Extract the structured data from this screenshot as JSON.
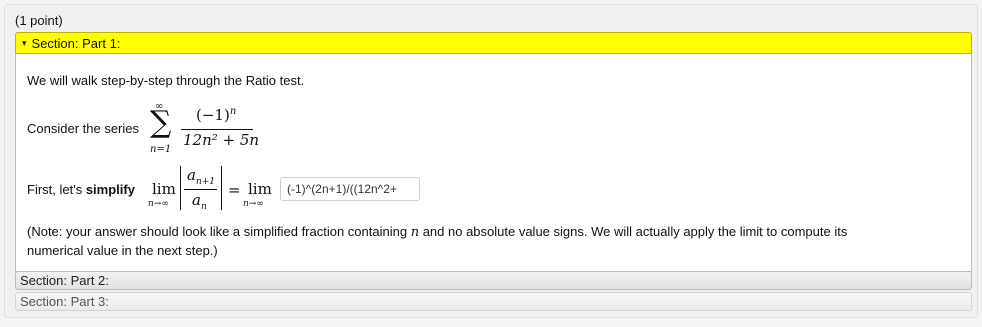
{
  "points": "(1 point)",
  "section1": {
    "caret": "▾",
    "title": "Section: Part 1:",
    "intro": "We will walk step-by-step through the Ratio test.",
    "consider_label": "Consider the series",
    "sum_upper": "∞",
    "sum_lower": "n=1",
    "sum_symbol": "∑",
    "series_numerator": "(−1)",
    "series_numerator_exp": "n",
    "series_denominator": "12n² + 5n",
    "simplify_prefix": "First, let's ",
    "simplify_bold": "simplify",
    "lim": "lim",
    "lim_sub": "n→∞",
    "ratio_num": "a",
    "ratio_num_sub": "n+1",
    "ratio_den": "a",
    "ratio_den_sub": "n",
    "equals": "=",
    "answer_value": "(-1)^(2n+1)/((12n^2+",
    "note_prefix": "(Note: your answer should look like a simplified fraction containing ",
    "note_var": "n",
    "note_suffix_line1": " and no absolute value signs. We will actually apply the limit to compute its",
    "note_line2": "numerical value in the next step.)"
  },
  "section2": {
    "title": "Section: Part 2:"
  },
  "section3": {
    "title": "Section: Part 3:"
  }
}
